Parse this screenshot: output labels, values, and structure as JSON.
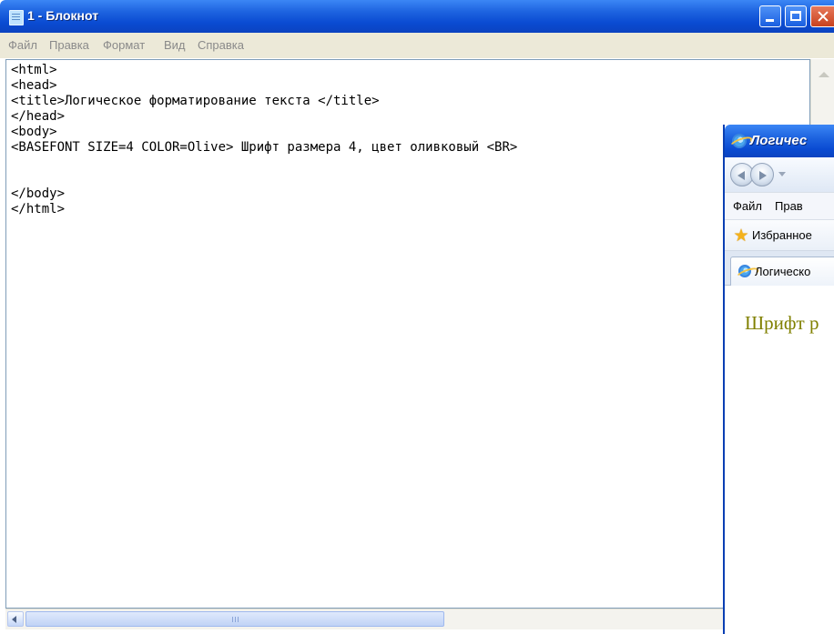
{
  "notepad": {
    "title": "1 - Блокнот",
    "menu": [
      "Файл",
      "Правка",
      "Формат",
      "Вид",
      "Справка"
    ],
    "content": "<html>\n<head>\n<title>Логическое форматирование текста </title>\n</head>\n<body>\n<BASEFONT SIZE=4 COLOR=Olive> Шрифт размера 4, цвет оливковый <BR>\n\n\n</body>\n</html>"
  },
  "browser": {
    "title": "Логичес",
    "menu": [
      "Файл",
      "Прав"
    ],
    "favorites_label": "Избранное",
    "tab_label": "Логическо",
    "page_text": "Шрифт р",
    "page_text_color": "#808000"
  },
  "icons": {
    "notepad_app": "notepad-icon",
    "browser_app": "internet-explorer-icon",
    "favorites": "star-icon"
  }
}
